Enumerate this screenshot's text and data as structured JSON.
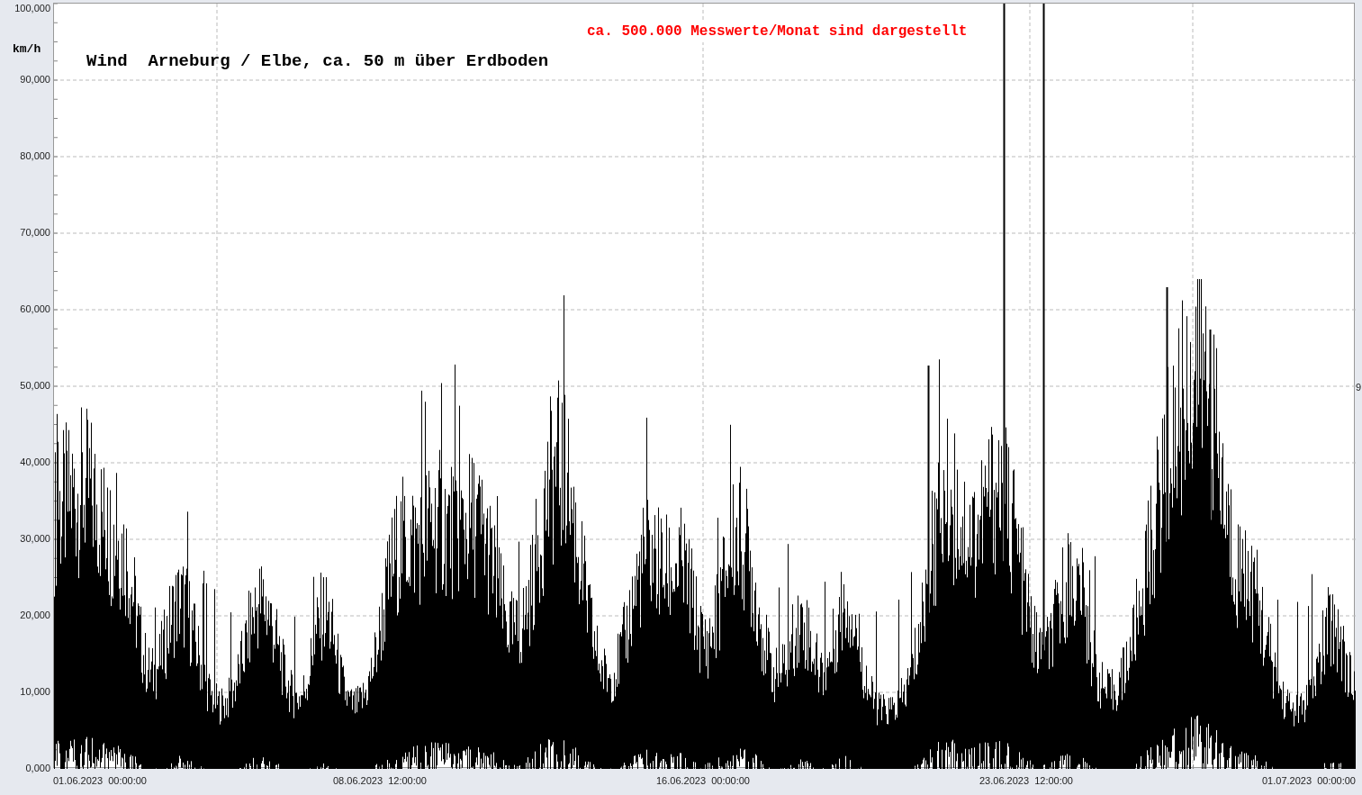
{
  "chart": {
    "unit": "km/h",
    "title": "Wind  Arneburg / Elbe, ca. 50 m über Erdboden",
    "note": "ca. 500.000 Messwerte/Monat sind dargestellt",
    "y_tick_labels": [
      "100,000",
      "90,000",
      "80,000",
      "70,000",
      "60,000",
      "50,000",
      "40,000",
      "30,000",
      "20,000",
      "10,000",
      "0,000"
    ],
    "x_tick_labels": [
      "01.06.2023  00:00:00",
      "08.06.2023  12:00:00",
      "16.06.2023  00:00:00",
      "23.06.2023  12:00:00",
      "01.07.2023  00:00:00"
    ],
    "right_edge_label": "9"
  }
}
